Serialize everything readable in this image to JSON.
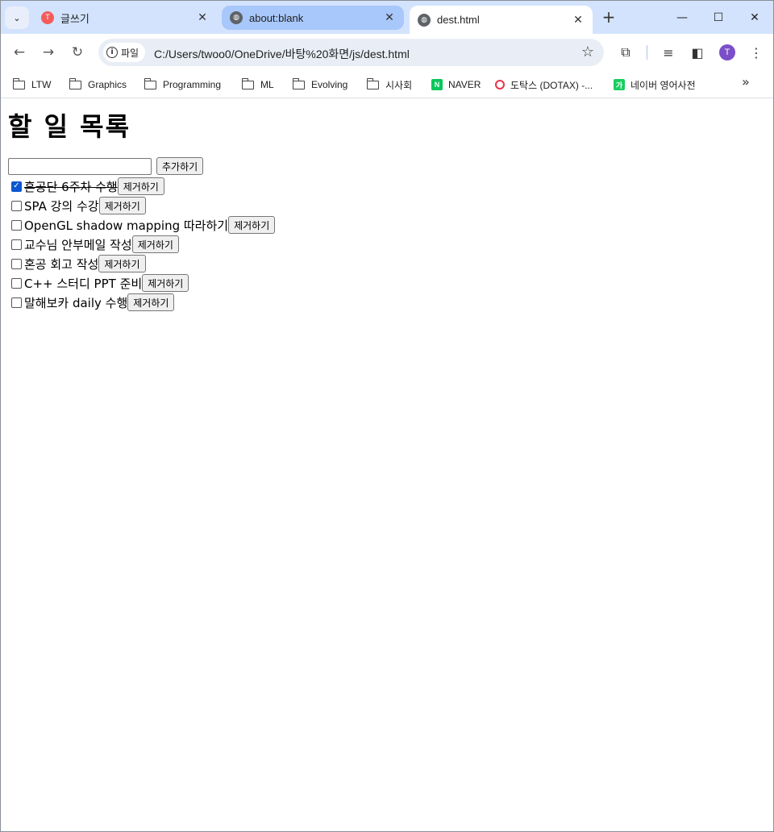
{
  "browser": {
    "tabs": [
      {
        "title": "글쓰기",
        "favicon_color": "#f45b5b",
        "state": "inactive"
      },
      {
        "title": "about:blank",
        "favicon_color": "#5f6368",
        "state": "inactive-hover"
      },
      {
        "title": "dest.html",
        "favicon_color": "#5f6368",
        "state": "active"
      }
    ],
    "new_tab_label": "+",
    "omnibox": {
      "security_chip": "파일",
      "url": "C:/Users/twoo0/OneDrive/바탕%20화면/js/dest.html"
    },
    "profile_initial": "T",
    "bookmarks": [
      {
        "label": "LTW",
        "type": "folder"
      },
      {
        "label": "Graphics",
        "type": "folder"
      },
      {
        "label": "Programming",
        "type": "folder"
      },
      {
        "label": "ML",
        "type": "folder"
      },
      {
        "label": "Evolving",
        "type": "folder"
      },
      {
        "label": "시사회",
        "type": "folder"
      },
      {
        "label": "NAVER",
        "type": "site",
        "icon_text": "N",
        "color": "#03c75a"
      },
      {
        "label": "도탁스 (DOTAX) -...",
        "type": "site",
        "icon_text": "",
        "color": "#e8334a"
      },
      {
        "label": "네이버 영어사전",
        "type": "site",
        "icon_text": "가",
        "color": "#19ce60"
      }
    ],
    "more_label": "»"
  },
  "page": {
    "heading": "할 일 목록",
    "new_todo_input": {
      "value": "",
      "placeholder": ""
    },
    "add_button": "추가하기",
    "remove_button": "제거하기",
    "todos": [
      {
        "text": "혼공단 6주차 수행",
        "checked": true
      },
      {
        "text": "SPA 강의 수강",
        "checked": false
      },
      {
        "text": "OpenGL shadow mapping 따라하기",
        "checked": false
      },
      {
        "text": "교수님 안부메일 작성",
        "checked": false
      },
      {
        "text": "혼공 회고 작성",
        "checked": false
      },
      {
        "text": "C++ 스터디 PPT 준비",
        "checked": false
      },
      {
        "text": "말해보카 daily 수행",
        "checked": false
      }
    ]
  }
}
